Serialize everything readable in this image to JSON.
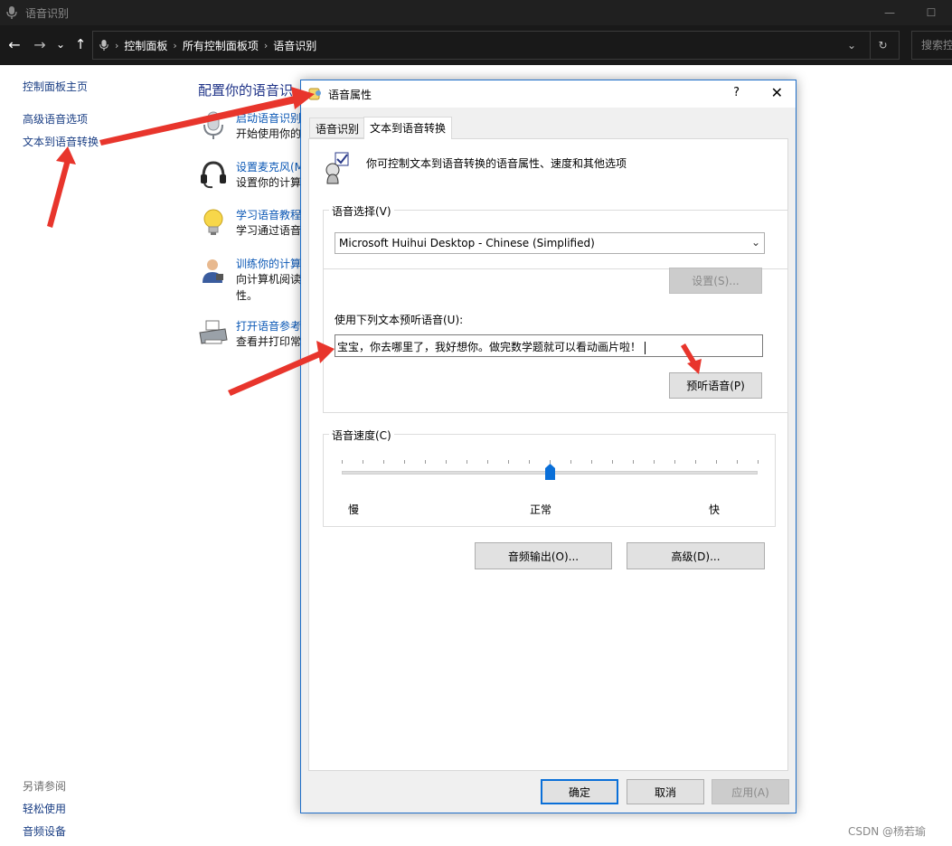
{
  "window": {
    "title": "语音识别",
    "minimize_glyph": "—",
    "maximize_glyph": "☐"
  },
  "addressbar": {
    "back_glyph": "←",
    "forward_glyph": "→",
    "recent_glyph": "⌄",
    "up_glyph": "↑",
    "crumbs": [
      "控制面板",
      "所有控制面板项",
      "语音识别"
    ],
    "separator": "›",
    "dropdown_glyph": "⌄",
    "refresh_glyph": "↻",
    "search_placeholder": "搜索控"
  },
  "leftnav": {
    "home": "控制面板主页",
    "advanced": "高级语音选项",
    "tts": "文本到语音转换",
    "see_also_title": "另请参阅",
    "ease_of_access": "轻松使用",
    "audio_devices": "音频设备"
  },
  "main": {
    "title": "配置你的语音识",
    "tasks": [
      {
        "link": "启动语音识别",
        "desc": "开始使用你的",
        "icon": "microphone-icon"
      },
      {
        "link": "设置麦克风(M",
        "desc": "设置你的计算",
        "icon": "headset-icon"
      },
      {
        "link": "学习语音教程",
        "desc": "学习通过语音",
        "icon": "lightbulb-icon"
      },
      {
        "link": "训练你的计算",
        "desc": "向计算机阅读",
        "desc2": "性。",
        "icon": "person-icon"
      },
      {
        "link": "打开语音参考",
        "desc": "查看并打印常",
        "icon": "printer-icon"
      }
    ]
  },
  "dialog": {
    "title": "语音属性",
    "help": "?",
    "close": "✕",
    "tabs": [
      "语音识别",
      "文本到语音转换"
    ],
    "active_tab": 1,
    "intro": "你可控制文本到语音转换的语音属性、速度和其他选项",
    "voice_group": "语音选择(V)",
    "voice_selected": "Microsoft Huihui Desktop - Chinese (Simplified)",
    "combo_arrow": "⌄",
    "settings_button": "设置(S)...",
    "preview_label": "使用下列文本预听语音(U):",
    "preview_text": "宝宝，你去哪里了，我好想你。做完数学题就可以看动画片啦！",
    "preview_button": "预听语音(P)",
    "speed_group": "语音速度(C)",
    "speed_level": 0.5,
    "speed_slow": "慢",
    "speed_normal": "正常",
    "speed_fast": "快",
    "audio_output_button": "音频输出(O)...",
    "advanced_button": "高级(D)...",
    "ok_button": "确定",
    "cancel_button": "取消",
    "apply_button": "应用(A)"
  },
  "watermark": "CSDN @杨若瑜",
  "colors": {
    "annotation_arrow": "#e8352c",
    "accent": "#0a6fd8",
    "link": "#0a57b5"
  }
}
